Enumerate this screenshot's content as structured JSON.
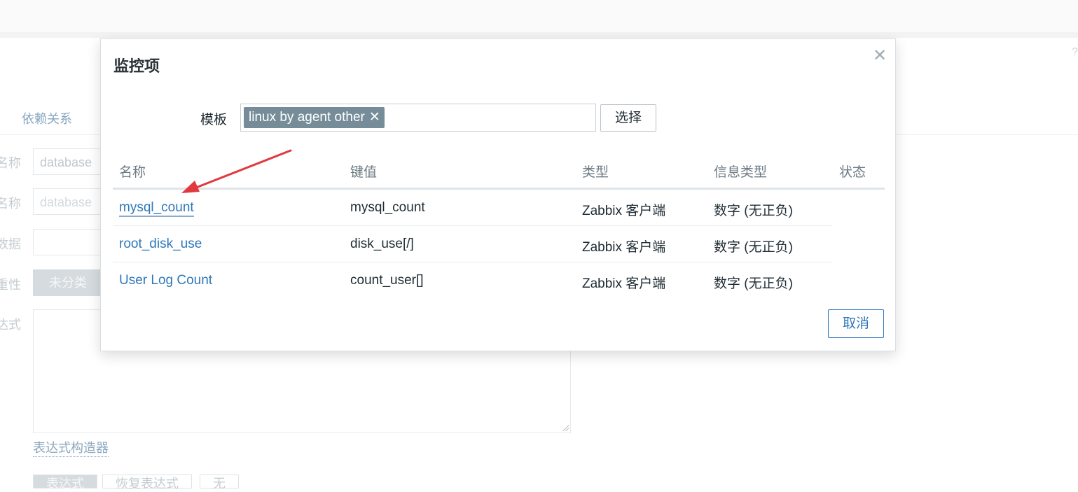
{
  "background": {
    "tab_label": "依赖关系",
    "labels": [
      "名称",
      "名称",
      "数据",
      "重性",
      "达式"
    ],
    "inputs": [
      "database",
      "database",
      ""
    ],
    "severity_button": "未分类",
    "expression_builder_link": "表达式构造器",
    "segments": [
      "表达式",
      "恢复表达式",
      "无"
    ],
    "help_mark": "?"
  },
  "modal": {
    "title": "监控项",
    "close_icon": "close-icon",
    "template_label": "模板",
    "template_chip": "linux by agent other",
    "chip_remove": "✕",
    "select_button": "选择",
    "columns": [
      "名称",
      "键值",
      "类型",
      "信息类型",
      "状态"
    ],
    "rows": [
      {
        "name": "mysql_count",
        "key": "mysql_count",
        "type": "Zabbix 客户端",
        "info_type": "数字 (无正负)",
        "status": ""
      },
      {
        "name": "root_disk_use",
        "key": "disk_use[/]",
        "type": "Zabbix 客户端",
        "info_type": "数字 (无正负)",
        "status": ""
      },
      {
        "name": "User Log Count",
        "key": "count_user[]",
        "type": "Zabbix 客户端",
        "info_type": "数字 (无正负)",
        "status": ""
      }
    ],
    "cancel_button": "取消"
  },
  "colors": {
    "link": "#2f78b9",
    "chip": "#768d99",
    "arrow": "#e0393e"
  }
}
